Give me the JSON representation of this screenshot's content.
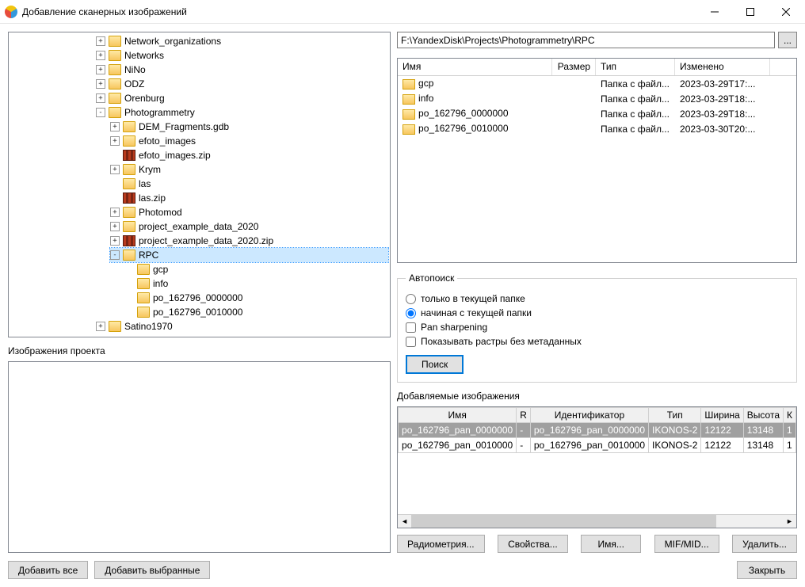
{
  "window": {
    "title": "Добавление сканерных изображений"
  },
  "tree": {
    "items": [
      {
        "label": "Network_organizations",
        "depth": 0,
        "exp": "+",
        "icon": "folder"
      },
      {
        "label": "Networks",
        "depth": 0,
        "exp": "+",
        "icon": "folder"
      },
      {
        "label": "NiNo",
        "depth": 0,
        "exp": "+",
        "icon": "folder"
      },
      {
        "label": "ODZ",
        "depth": 0,
        "exp": "+",
        "icon": "folder"
      },
      {
        "label": "Orenburg",
        "depth": 0,
        "exp": "+",
        "icon": "folder"
      },
      {
        "label": "Photogrammetry",
        "depth": 0,
        "exp": "-",
        "icon": "folder"
      },
      {
        "label": "DEM_Fragments.gdb",
        "depth": 1,
        "exp": "+",
        "icon": "folder"
      },
      {
        "label": "efoto_images",
        "depth": 1,
        "exp": "+",
        "icon": "folder"
      },
      {
        "label": "efoto_images.zip",
        "depth": 1,
        "exp": " ",
        "icon": "zip"
      },
      {
        "label": "Krym",
        "depth": 1,
        "exp": "+",
        "icon": "folder"
      },
      {
        "label": "las",
        "depth": 1,
        "exp": " ",
        "icon": "folder"
      },
      {
        "label": "las.zip",
        "depth": 1,
        "exp": " ",
        "icon": "zip"
      },
      {
        "label": "Photomod",
        "depth": 1,
        "exp": "+",
        "icon": "folder"
      },
      {
        "label": "project_example_data_2020",
        "depth": 1,
        "exp": "+",
        "icon": "folder"
      },
      {
        "label": "project_example_data_2020.zip",
        "depth": 1,
        "exp": "+",
        "icon": "zip"
      },
      {
        "label": "RPC",
        "depth": 1,
        "exp": "-",
        "icon": "folder",
        "selected": true
      },
      {
        "label": "gcp",
        "depth": 2,
        "exp": " ",
        "icon": "folder"
      },
      {
        "label": "info",
        "depth": 2,
        "exp": " ",
        "icon": "folder"
      },
      {
        "label": "po_162796_0000000",
        "depth": 2,
        "exp": " ",
        "icon": "folder"
      },
      {
        "label": "po_162796_0010000",
        "depth": 2,
        "exp": " ",
        "icon": "folder"
      },
      {
        "label": "Satino1970",
        "depth": 0,
        "exp": "+",
        "icon": "folder"
      }
    ]
  },
  "project_images_label": "Изображения проекта",
  "path": {
    "value": "F:\\YandexDisk\\Projects\\Photogrammetry\\RPC",
    "browse": "..."
  },
  "filelist": {
    "headers": {
      "name": "Имя",
      "size": "Размер",
      "type": "Тип",
      "modified": "Изменено"
    },
    "rows": [
      {
        "name": "gcp",
        "type": "Папка с файл...",
        "modified": "2023-03-29T17:..."
      },
      {
        "name": "info",
        "type": "Папка с файл...",
        "modified": "2023-03-29T18:..."
      },
      {
        "name": "po_162796_0000000",
        "type": "Папка с файл...",
        "modified": "2023-03-29T18:..."
      },
      {
        "name": "po_162796_0010000",
        "type": "Папка с файл...",
        "modified": "2023-03-30T20:..."
      }
    ]
  },
  "autosearch": {
    "legend": "Автопоиск",
    "opt_only": "только в текущей папке",
    "opt_from": "начиная с текущей папки",
    "pan": "Pan sharpening",
    "show_no_meta": "Показывать растры без метаданных",
    "search": "Поиск"
  },
  "added_images_label": "Добавляемые изображения",
  "grid": {
    "headers": {
      "name": "Имя",
      "r": "R",
      "id": "Идентификатор",
      "type": "Тип",
      "w": "Ширина",
      "h": "Высота",
      "k": "К"
    },
    "rows": [
      {
        "name": "po_162796_pan_0000000",
        "r": "-",
        "id": "po_162796_pan_0000000",
        "type": "IKONOS-2",
        "w": "12122",
        "h": "13148",
        "k": "1",
        "sel": true
      },
      {
        "name": "po_162796_pan_0010000",
        "r": "-",
        "id": "po_162796_pan_0010000",
        "type": "IKONOS-2",
        "w": "12122",
        "h": "13148",
        "k": "1"
      }
    ]
  },
  "buttons": {
    "radiometry": "Радиометрия...",
    "props": "Свойства...",
    "name": "Имя...",
    "mifmid": "MIF/MID...",
    "delete": "Удалить..."
  },
  "footer": {
    "add_all": "Добавить все",
    "add_sel": "Добавить выбранные",
    "close": "Закрыть"
  }
}
